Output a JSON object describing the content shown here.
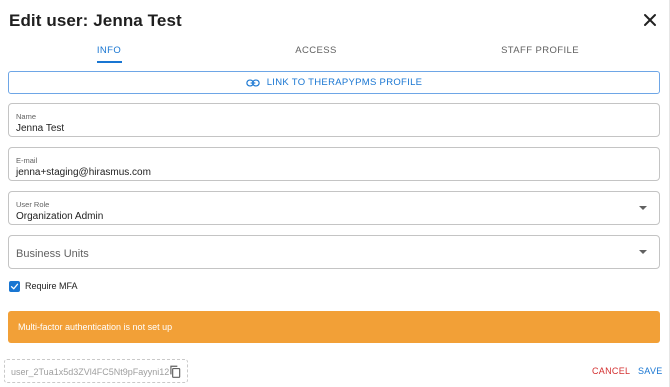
{
  "dialog": {
    "title": "Edit user: Jenna Test"
  },
  "tabs": [
    {
      "label": "INFO",
      "active": true
    },
    {
      "label": "ACCESS",
      "active": false
    },
    {
      "label": "STAFF PROFILE",
      "active": false
    }
  ],
  "link_button": {
    "label": "LINK TO THERAPYPMS PROFILE",
    "icon": "link-icon"
  },
  "fields": {
    "name": {
      "label": "Name",
      "value": "Jenna Test"
    },
    "email": {
      "label": "E-mail",
      "value": "jenna+staging@hirasmus.com"
    },
    "user_role": {
      "label": "User Role",
      "value": "Organization Admin"
    },
    "business_units": {
      "placeholder": "Business Units"
    }
  },
  "mfa": {
    "label": "Require MFA",
    "checked": true
  },
  "banner": {
    "text": "Multi-factor authentication is not set up",
    "color": "#f2a037"
  },
  "user_id": {
    "value": "user_2Tua1x5d3ZVl4FC5Nt9pFayyni12",
    "icon": "copy-icon"
  },
  "actions": {
    "cancel": "CANCEL",
    "save": "SAVE"
  },
  "colors": {
    "primary": "#1976d2",
    "danger": "#d32f2f",
    "warning": "#f2a037"
  }
}
